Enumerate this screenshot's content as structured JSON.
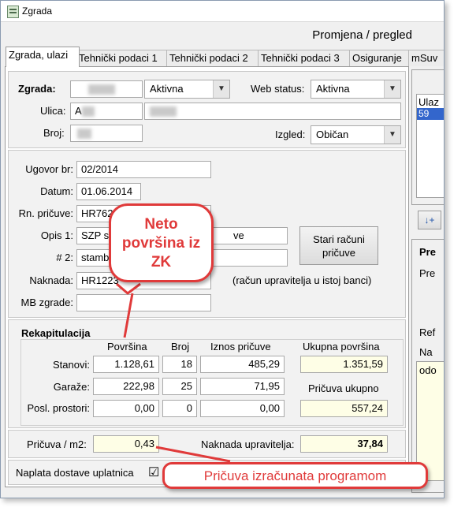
{
  "window": {
    "title": "Zgrada"
  },
  "header": {
    "mode": "Promjena / pregled"
  },
  "tabs": [
    {
      "label": "Zgrada, ulazi"
    },
    {
      "label": "Tehnički podaci 1"
    },
    {
      "label": "Tehnički podaci 2"
    },
    {
      "label": "Tehnički podaci 3"
    },
    {
      "label": "Osiguranje"
    },
    {
      "label": "mSuv"
    }
  ],
  "building": {
    "zgrada_label": "Zgrada:",
    "status_value": "Aktivna",
    "web_status_label": "Web status:",
    "web_status_value": "Aktivna",
    "ulica_label": "Ulica:",
    "ulica_prefix": "A",
    "broj_label": "Broj:",
    "izgled_label": "Izgled:",
    "izgled_value": "Običan"
  },
  "contract": {
    "ugovor_label": "Ugovor br:",
    "ugovor_value": "02/2014",
    "datum_label": "Datum:",
    "datum_value": "01.06.2014",
    "racun_label": "Rn. pričuve:",
    "racun_value": "HR762",
    "opis1_label": "Opis 1:",
    "opis1_value": "SZP s",
    "opis1_tail": "ve",
    "opis2_label": "# 2:",
    "opis2_value": "stamb",
    "naknada_label": "Naknada:",
    "naknada_value": "HR1223",
    "naknada_note": "(račun upravitelja u istoj banci)",
    "mb_label": "MB zgrade:",
    "stari_racuni_button": "Stari računi pričuve"
  },
  "recap": {
    "title": "Rekapitulacija",
    "headers": {
      "povrsina": "Površina",
      "broj": "Broj",
      "iznos": "Iznos pričuve",
      "ukupna": "Ukupna površina"
    },
    "rows": [
      {
        "label": "Stanovi:",
        "povrsina": "1.128,61",
        "broj": "18",
        "iznos": "485,29"
      },
      {
        "label": "Garaže:",
        "povrsina": "222,98",
        "broj": "25",
        "iznos": "71,95"
      },
      {
        "label": "Posl. prostori:",
        "povrsina": "0,00",
        "broj": "0",
        "iznos": "0,00"
      }
    ],
    "ukupna_povrsina_value": "1.351,59",
    "pricuva_ukupno_label": "Pričuva ukupno",
    "pricuva_ukupno_value": "557,24",
    "pricuva_m2_label": "Pričuva / m2:",
    "pricuva_m2_value": "0,43",
    "naknada_upravitelja_label": "Naknada upravitelja:",
    "naknada_upravitelja_value": "37,84"
  },
  "footer": {
    "naplata_label": "Naplata dostave uplatnica",
    "naplata_checked": true,
    "check_glyph": "☑"
  },
  "side_panel": {
    "list_header": "Ulaz",
    "list_item": "59",
    "sort_button": "↓+",
    "title_prefix": "Pre",
    "line1": "Pre",
    "line2": "Ref",
    "line3": "Na",
    "line4": "odo"
  },
  "annotations": {
    "neto_callout": "Neto površina iz ZK",
    "pricuva_callout": "Pričuva izračunata programom"
  },
  "colors": {
    "callout_red": "#e03a3a",
    "highlight_blue": "#3366cc",
    "yellow_field": "#fefee6"
  }
}
